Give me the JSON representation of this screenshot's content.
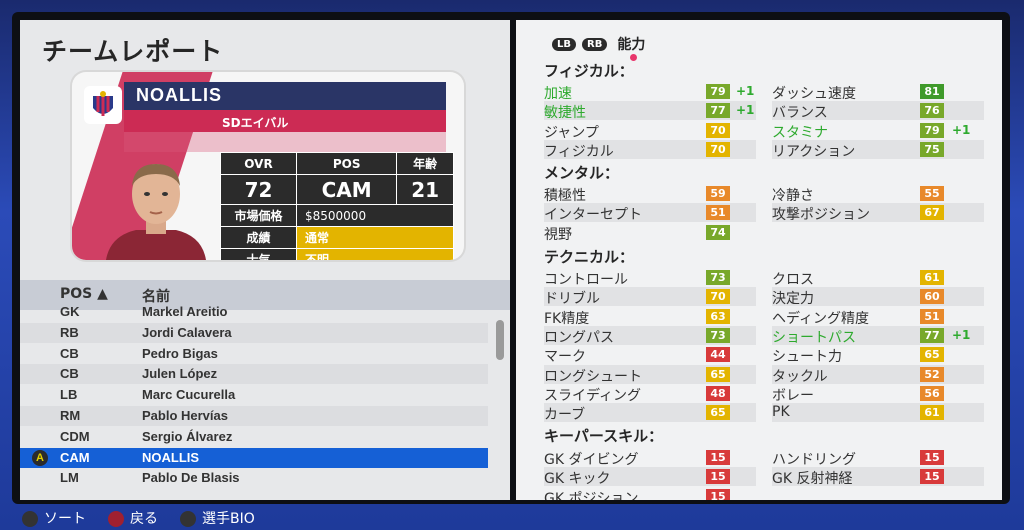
{
  "title": "チームレポート",
  "player": {
    "name": "NOALLIS",
    "club": "SDエイバル",
    "stats_headers": [
      "OVR",
      "POS",
      "年齢"
    ],
    "ovr": "72",
    "pos": "CAM",
    "age": "21",
    "market_value_label": "市場価格",
    "market_value": "$8500000",
    "form_label": "成績",
    "form_value": "通常",
    "morale_label": "士気",
    "morale_value": "不明"
  },
  "roster": {
    "col_pos": "POS ▲",
    "col_name": "名前",
    "rows": [
      {
        "pos": "GK",
        "name": "Markel Areitio"
      },
      {
        "pos": "RB",
        "name": "Jordi Calavera"
      },
      {
        "pos": "CB",
        "name": "Pedro Bigas"
      },
      {
        "pos": "CB",
        "name": "Julen López"
      },
      {
        "pos": "LB",
        "name": "Marc Cucurella"
      },
      {
        "pos": "RM",
        "name": "Pablo Hervías"
      },
      {
        "pos": "CDM",
        "name": "Sergio Álvarez"
      },
      {
        "pos": "CAM",
        "name": "NOALLIS"
      },
      {
        "pos": "LM",
        "name": "Pablo De Blasis"
      }
    ],
    "selected_marker": "A"
  },
  "tabs": {
    "lb": "LB",
    "rb": "RB",
    "label": "能力"
  },
  "sections": {
    "physical": "フィジカル：",
    "mental": "メンタル：",
    "technical": "テクニカル：",
    "gk": "キーパースキル："
  },
  "physical": [
    {
      "name": "加速",
      "value": "79",
      "delta": "+1",
      "green": true,
      "color": "#78a82a"
    },
    {
      "name": "敏捷性",
      "value": "77",
      "delta": "+1",
      "green": true,
      "color": "#78a82a"
    },
    {
      "name": "ジャンプ",
      "value": "70",
      "delta": "",
      "green": false,
      "color": "#e3b400"
    },
    {
      "name": "フィジカル",
      "value": "70",
      "delta": "",
      "green": false,
      "color": "#e3b400"
    },
    {
      "name": "ダッシュ速度",
      "value": "81",
      "delta": "",
      "green": false,
      "color": "#3f9a2a"
    },
    {
      "name": "バランス",
      "value": "76",
      "delta": "",
      "green": false,
      "color": "#78a82a"
    },
    {
      "name": "スタミナ",
      "value": "79",
      "delta": "+1",
      "green": true,
      "color": "#78a82a"
    },
    {
      "name": "リアクション",
      "value": "75",
      "delta": "",
      "green": false,
      "color": "#78a82a"
    }
  ],
  "mental": [
    {
      "name": "積極性",
      "value": "59",
      "delta": "",
      "green": false,
      "color": "#e8892a"
    },
    {
      "name": "インターセプト",
      "value": "51",
      "delta": "",
      "green": false,
      "color": "#e8892a"
    },
    {
      "name": "視野",
      "value": "74",
      "delta": "",
      "green": false,
      "color": "#78a82a"
    },
    {
      "name": "冷静さ",
      "value": "55",
      "delta": "",
      "green": false,
      "color": "#e8892a"
    },
    {
      "name": "攻撃ポジション",
      "value": "67",
      "delta": "",
      "green": false,
      "color": "#e3b400"
    }
  ],
  "technical": [
    {
      "name": "コントロール",
      "value": "73",
      "delta": "",
      "green": false,
      "color": "#78a82a"
    },
    {
      "name": "ドリブル",
      "value": "70",
      "delta": "",
      "green": false,
      "color": "#e3b400"
    },
    {
      "name": "FK精度",
      "value": "63",
      "delta": "",
      "green": false,
      "color": "#e3b400"
    },
    {
      "name": "ロングパス",
      "value": "73",
      "delta": "",
      "green": false,
      "color": "#78a82a"
    },
    {
      "name": "マーク",
      "value": "44",
      "delta": "",
      "green": false,
      "color": "#d83a3a"
    },
    {
      "name": "ロングシュート",
      "value": "65",
      "delta": "",
      "green": false,
      "color": "#e3b400"
    },
    {
      "name": "スライディング",
      "value": "48",
      "delta": "",
      "green": false,
      "color": "#d83a3a"
    },
    {
      "name": "カーブ",
      "value": "65",
      "delta": "",
      "green": false,
      "color": "#e3b400"
    },
    {
      "name": "クロス",
      "value": "61",
      "delta": "",
      "green": false,
      "color": "#e3b400"
    },
    {
      "name": "決定力",
      "value": "60",
      "delta": "",
      "green": false,
      "color": "#e8892a"
    },
    {
      "name": "ヘディング精度",
      "value": "51",
      "delta": "",
      "green": false,
      "color": "#e8892a"
    },
    {
      "name": "ショートパス",
      "value": "77",
      "delta": "+1",
      "green": true,
      "color": "#78a82a"
    },
    {
      "name": "シュート力",
      "value": "65",
      "delta": "",
      "green": false,
      "color": "#e3b400"
    },
    {
      "name": "タックル",
      "value": "52",
      "delta": "",
      "green": false,
      "color": "#e8892a"
    },
    {
      "name": "ボレー",
      "value": "56",
      "delta": "",
      "green": false,
      "color": "#e8892a"
    },
    {
      "name": "PK",
      "value": "61",
      "delta": "",
      "green": false,
      "color": "#e3b400"
    }
  ],
  "gk": [
    {
      "name": "GK ダイビング",
      "value": "15",
      "delta": "",
      "green": false,
      "color": "#d83a3a"
    },
    {
      "name": "GK キック",
      "value": "15",
      "delta": "",
      "green": false,
      "color": "#d83a3a"
    },
    {
      "name": "GK ポジション",
      "value": "15",
      "delta": "",
      "green": false,
      "color": "#d83a3a"
    },
    {
      "name": "ハンドリング",
      "value": "15",
      "delta": "",
      "green": false,
      "color": "#d83a3a"
    },
    {
      "name": "GK 反射神経",
      "value": "15",
      "delta": "",
      "green": false,
      "color": "#d83a3a"
    }
  ],
  "footer": {
    "sort": "ソート",
    "back": "戻る",
    "select": "選手BIO"
  }
}
